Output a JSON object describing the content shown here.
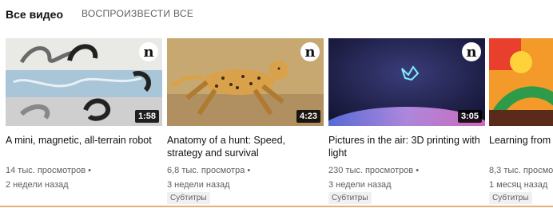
{
  "section": {
    "title": "Все видео",
    "play_all": "ВОСПРОИЗВЕСТИ ВСЕ"
  },
  "videos": [
    {
      "title": "A mini, magnetic, all-terrain robot",
      "duration": "1:58",
      "views": "14 тыс. просмотров",
      "age": "2 недели назад",
      "badge": "",
      "channel_logo_icon": "ted-n-logo-icon"
    },
    {
      "title": "Anatomy of a hunt: Speed, strategy and survival",
      "duration": "4:23",
      "views": "6,8 тыс. просмотра",
      "age": "3 недели назад",
      "badge": "Субтитры",
      "channel_logo_icon": "ted-n-logo-icon"
    },
    {
      "title": "Pictures in the air: 3D printing with light",
      "duration": "3:05",
      "views": "230 тыс. просмотров",
      "age": "3 недели назад",
      "badge": "Субтитры",
      "channel_logo_icon": "ted-n-logo-icon"
    },
    {
      "title": "Learning from green with art",
      "duration": "",
      "views": "8,3 тыс. просмо",
      "age": "1 месяц назад",
      "badge": "Субтитры",
      "channel_logo_icon": ""
    }
  ],
  "colors": {
    "divider": "#e8b07a",
    "duration_bg": "#000000",
    "meta_text": "#606060"
  }
}
